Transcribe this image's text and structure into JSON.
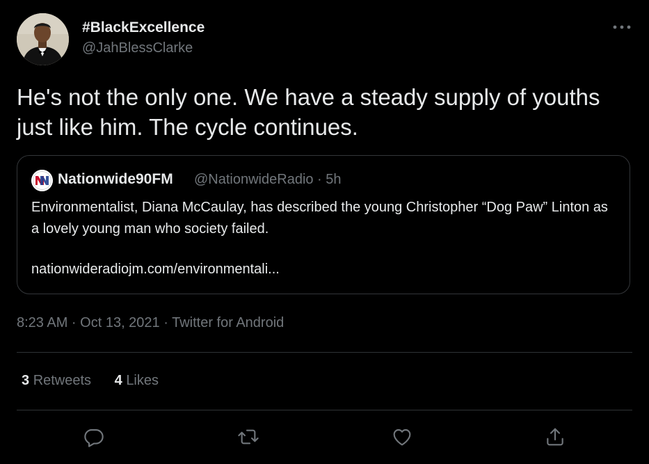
{
  "author": {
    "display_name": "#BlackExcellence",
    "handle": "@JahBlessClarke"
  },
  "tweet": {
    "text": "He's not the only one. We have a steady supply of youths just like him. The cycle continues."
  },
  "quote": {
    "name": "Nationwide90FM",
    "handle_time": "@NationwideRadio · 5h",
    "body": "Environmentalist, Diana McCaulay, has described the young Christopher “Dog Paw” Linton as a lovely young man who society failed.",
    "link": "nationwideradiojm.com/environmentali..."
  },
  "meta": {
    "timestamp": "8:23 AM · Oct 13, 2021 · Twitter for Android"
  },
  "stats": {
    "retweets_count": "3",
    "retweets_label": "Retweets",
    "likes_count": "4",
    "likes_label": "Likes"
  },
  "actions": {
    "icons": [
      "reply-icon",
      "retweet-icon",
      "like-icon",
      "share-icon"
    ]
  },
  "colors": {
    "background": "#000000",
    "text_primary": "#e7e9ea",
    "text_secondary": "#71767b",
    "border": "#2f3336"
  }
}
